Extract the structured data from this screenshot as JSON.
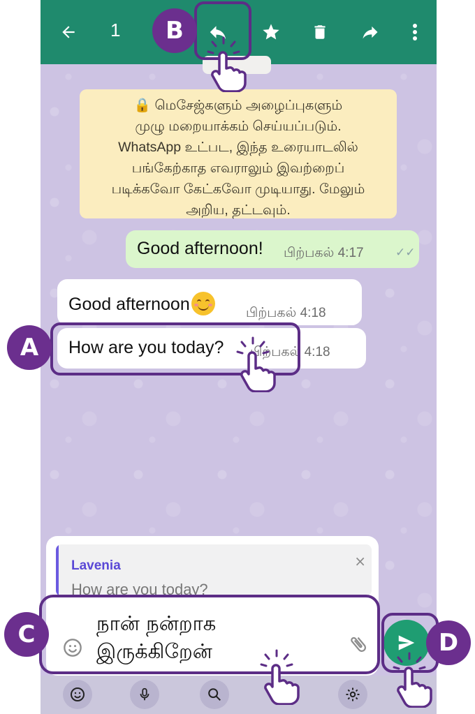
{
  "header": {
    "selected_count": "1",
    "icons": [
      "back-arrow-icon",
      "reply-icon",
      "star-icon",
      "delete-icon",
      "forward-icon",
      "more-options-icon"
    ]
  },
  "encryption_notice": {
    "lines": [
      "🔒 மெசேஜ்களும் அழைப்புகளும்",
      "முழு மறையாக்கம் செய்யப்படும்.",
      "WhatsApp உட்பட, இந்த உரையாடலில்",
      "பங்கேற்காத எவராலும் இவற்றைப்",
      "படிக்கவோ கேட்கவோ முடியாது. மேலும்",
      "அறிய, தட்டவும்."
    ]
  },
  "messages": [
    {
      "direction": "outgoing",
      "text": "Good afternoon!",
      "time": "பிற்பகல் 4:17",
      "status": "✓✓"
    },
    {
      "direction": "incoming",
      "text": "Good afternoon",
      "time": "பிற்பகல் 4:18",
      "emoji": "smiling-face-icon"
    },
    {
      "direction": "incoming",
      "text": "How are you today?",
      "time": "பிற்பகல் 4:18"
    }
  ],
  "reply_preview": {
    "name": "Lavenia",
    "text": "How are you today?",
    "close": "×"
  },
  "composer": {
    "lines": [
      "நான் நன்றாக",
      "இருக்கிறேன்"
    ]
  },
  "callouts": {
    "a": "A",
    "b": "B",
    "c": "C",
    "d": "D"
  },
  "colors": {
    "header": "#1f8a6d",
    "send": "#1f9d72",
    "callout": "#6b2f8e",
    "outgoing_bubble": "#dbf6cc",
    "notice": "#fbedbf"
  }
}
